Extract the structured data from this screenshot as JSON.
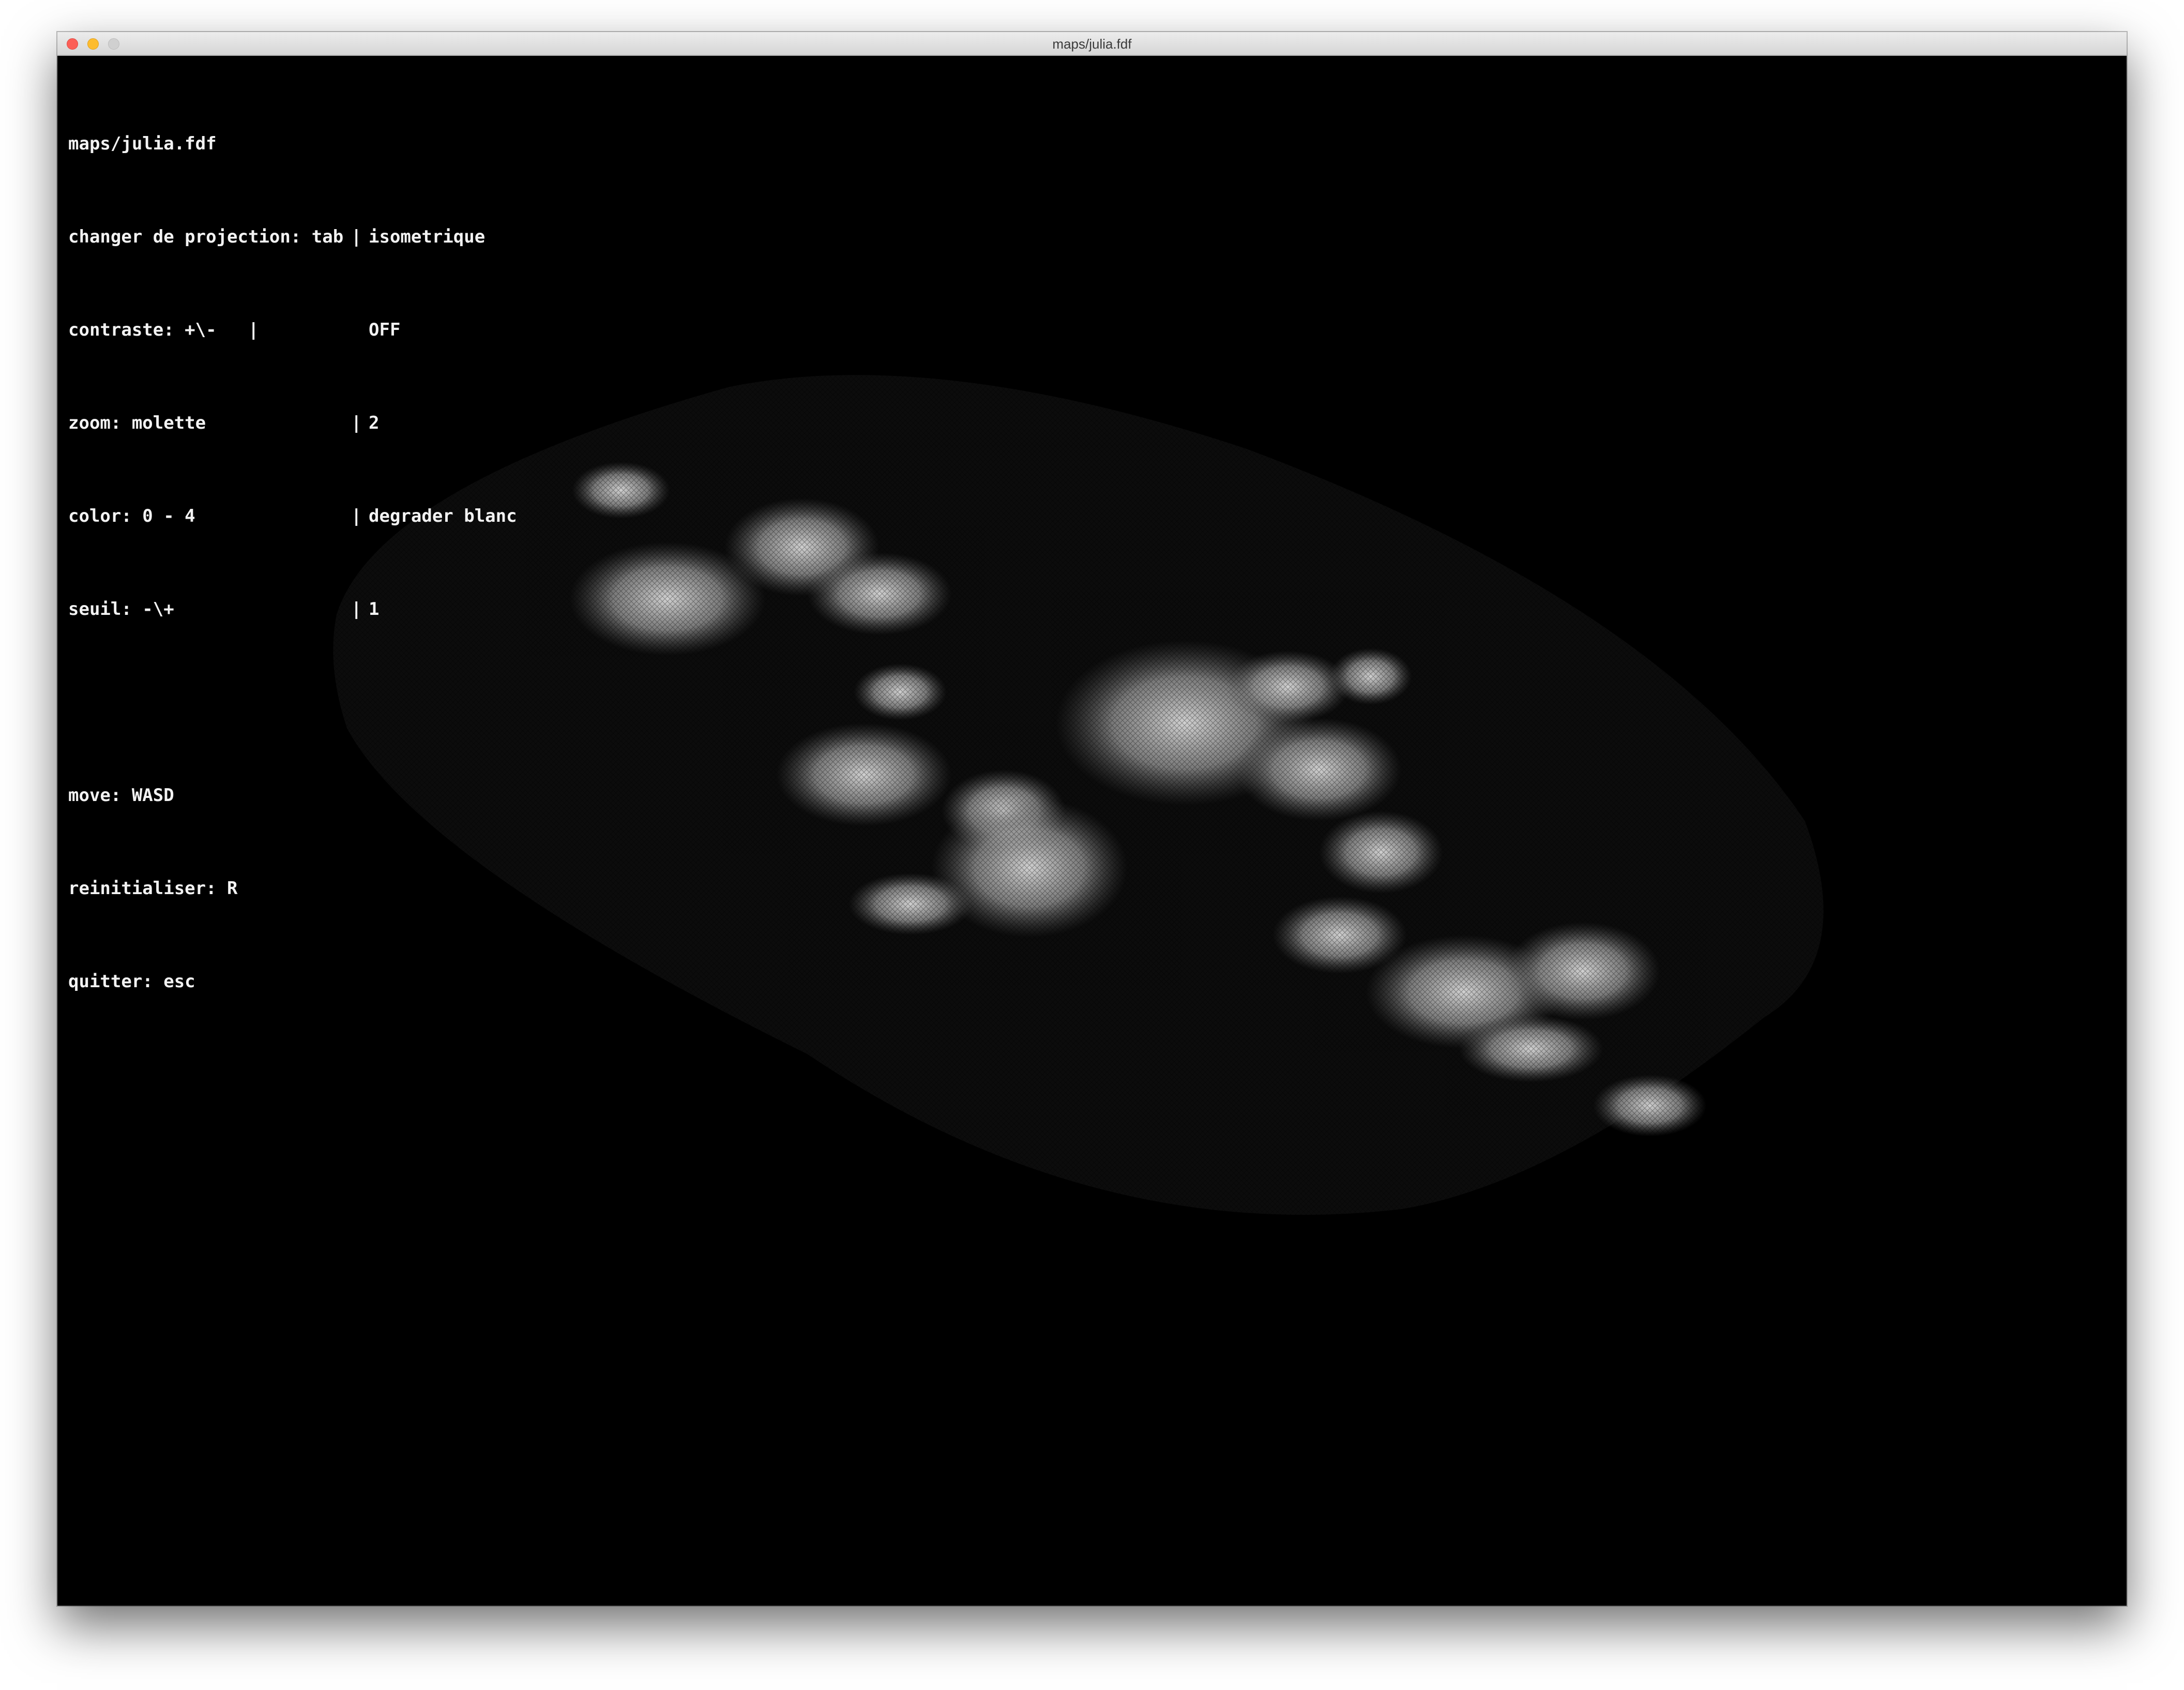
{
  "window": {
    "title": "maps/julia.fdf"
  },
  "hud": {
    "file": "maps/julia.fdf",
    "rows": [
      {
        "key": "changer de projection: tab",
        "value": "isometrique"
      },
      {
        "key": "contraste: +\\-   |",
        "value": "OFF"
      },
      {
        "key": "zoom: molette",
        "value": "2"
      },
      {
        "key": "color: 0 - 4",
        "value": "degrader blanc"
      },
      {
        "key": "seuil: -\\+",
        "value": "1"
      }
    ],
    "separator": "|",
    "move": "move: WASD",
    "reset": "reinitialiser: R",
    "quit": "quitter: esc"
  },
  "colors": {
    "background": "#000000",
    "text": "#f2f2f2",
    "plane": "#0c0c0c",
    "fractal": "#d9d9d9"
  },
  "icons": {
    "close": "close-icon",
    "minimize": "minimize-icon",
    "maximize": "maximize-icon"
  }
}
